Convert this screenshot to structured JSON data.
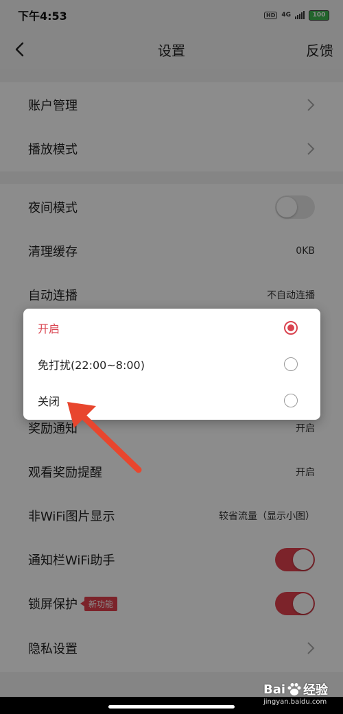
{
  "status_bar": {
    "time": "下午4:53",
    "hd": "HD",
    "network": "4G",
    "battery": "100",
    "battery_color": "#3fb651"
  },
  "nav": {
    "back_icon": "chevron-left-icon",
    "title": "设置",
    "action": "反馈"
  },
  "settings": {
    "account": "账户管理",
    "play_mode": "播放模式",
    "night_mode": "夜间模式",
    "clear_cache": "清理缓存",
    "cache_size": "0KB",
    "autoplay": "自动连播",
    "autoplay_value": "不自动连播",
    "reward_notice": "奖励通知",
    "reward_notice_value": "开启",
    "watch_reward": "观看奖励提醒",
    "watch_reward_value": "开启",
    "non_wifi_images": "非WiFi图片显示",
    "non_wifi_images_value": "较省流量（显示小图）",
    "wifi_assistant": "通知栏WiFi助手",
    "lock_screen": "锁屏保护",
    "new_badge": "新功能",
    "privacy": "隐私设置",
    "night_mode_on": false,
    "wifi_assistant_on": true,
    "lock_screen_on": true
  },
  "dialog": {
    "options": [
      {
        "label": "开启",
        "selected": true
      },
      {
        "label": "免打扰(22:00~8:00)",
        "selected": false
      },
      {
        "label": "关闭",
        "selected": false
      }
    ]
  },
  "watermark": {
    "brand": "Bai",
    "brand_suffix": "经验",
    "url": "jingyan.baidu.com"
  },
  "colors": {
    "accent": "#e2414e",
    "selected_text": "#d9434f",
    "annotation_arrow": "#e8462e"
  }
}
